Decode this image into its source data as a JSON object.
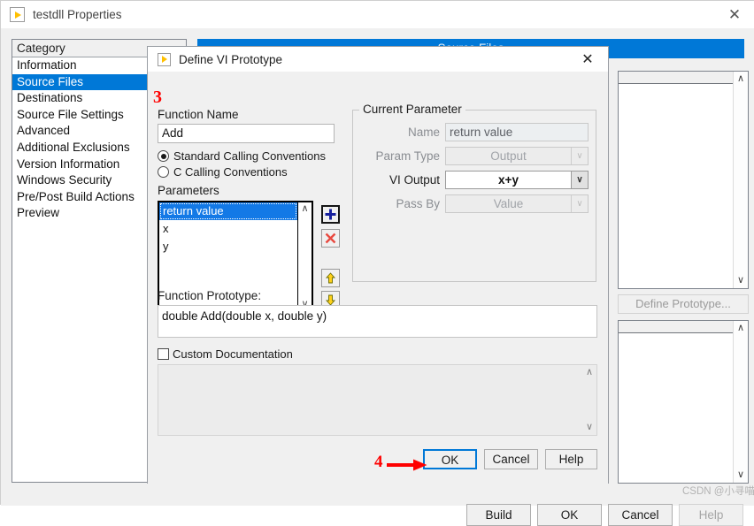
{
  "parent_window": {
    "title": "testdll Properties",
    "app_icon": "labview-vi-icon",
    "close_label": "✕",
    "category_header": "Category",
    "categories": [
      {
        "label": "Information",
        "selected": false
      },
      {
        "label": "Source Files",
        "selected": true
      },
      {
        "label": "Destinations",
        "selected": false
      },
      {
        "label": "Source File Settings",
        "selected": false
      },
      {
        "label": "Advanced",
        "selected": false
      },
      {
        "label": "Additional Exclusions",
        "selected": false
      },
      {
        "label": "Version Information",
        "selected": false
      },
      {
        "label": "Windows Security",
        "selected": false
      },
      {
        "label": "Pre/Post Build Actions",
        "selected": false
      },
      {
        "label": "Preview",
        "selected": false
      }
    ],
    "section_header": "Source Files",
    "define_prototype_button": "Define Prototype...",
    "buttons": {
      "build": "Build",
      "ok": "OK",
      "cancel": "Cancel",
      "help": "Help"
    },
    "watermark": "CSDN @小寻喵"
  },
  "dialog": {
    "title": "Define VI Prototype",
    "app_icon": "labview-vi-icon",
    "close_label": "✕",
    "step_marker": "3",
    "function_name_label": "Function Name",
    "function_name_value": "Add",
    "calling_conventions": [
      {
        "label": "Standard Calling Conventions",
        "selected": true
      },
      {
        "label": "C Calling Conventions",
        "selected": false
      }
    ],
    "parameters_label": "Parameters",
    "parameters": [
      {
        "label": "return value",
        "selected": true
      },
      {
        "label": "x",
        "selected": false
      },
      {
        "label": "y",
        "selected": false
      }
    ],
    "param_buttons": {
      "add": "+",
      "delete": "✕",
      "move_up": "↑",
      "move_down": "↓"
    },
    "current_parameter": {
      "legend": "Current Parameter",
      "name_label": "Name",
      "name_value": "return value",
      "param_type_label": "Param Type",
      "param_type_value": "Output",
      "vi_output_label": "VI Output",
      "vi_output_value": "x+y",
      "pass_by_label": "Pass By",
      "pass_by_value": "Value"
    },
    "function_prototype_label": "Function Prototype:",
    "function_prototype_value": "double Add(double x, double y)",
    "custom_documentation_label": "Custom Documentation",
    "custom_documentation_value": "",
    "custom_documentation_checked": false,
    "buttons": {
      "ok": "OK",
      "cancel": "Cancel",
      "help": "Help"
    },
    "step_marker_ok": "4"
  },
  "colors": {
    "accent_blue": "#0078d7",
    "selection_blue": "#1379e6",
    "annotation_red": "#fe0000",
    "window_gray": "#f0f0f0",
    "icon_yellow": "#ffc000"
  },
  "scroll_icons": {
    "up": "∧",
    "down": "∨"
  }
}
